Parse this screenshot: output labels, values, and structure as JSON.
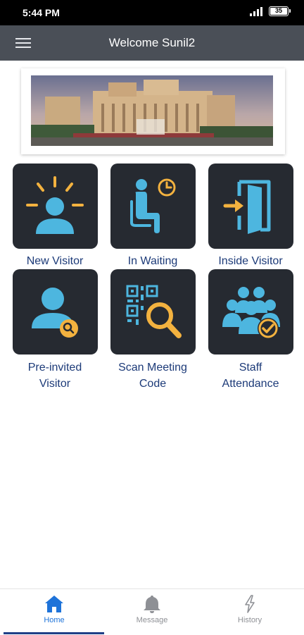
{
  "status_bar": {
    "time": "5:44 PM",
    "battery": "35"
  },
  "app_bar": {
    "title": "Welcome Sunil2"
  },
  "tiles": [
    {
      "label": "New Visitor",
      "icon": "new-visitor-icon"
    },
    {
      "label": "In Waiting",
      "icon": "waiting-icon"
    },
    {
      "label": "Inside Visitor",
      "icon": "door-enter-icon"
    },
    {
      "label": "Pre-invited\nVisitor",
      "icon": "pre-invited-icon"
    },
    {
      "label": "Scan Meeting\nCode",
      "icon": "qr-scan-icon"
    },
    {
      "label": "Staff\nAttendance",
      "icon": "staff-attendance-icon"
    }
  ],
  "bottom_nav": {
    "items": [
      {
        "label": "Home",
        "icon": "home-icon",
        "active": true
      },
      {
        "label": "Message",
        "icon": "bell-icon",
        "active": false
      },
      {
        "label": "History",
        "icon": "lightning-icon",
        "active": false
      }
    ]
  },
  "colors": {
    "app_bar": "#4a4f57",
    "tile_bg": "#262a31",
    "icon_blue": "#4db6df",
    "icon_amber": "#f3b23f",
    "label_text": "#1c3a78",
    "nav_active": "#1e73d9",
    "nav_inactive": "#8e9095"
  }
}
